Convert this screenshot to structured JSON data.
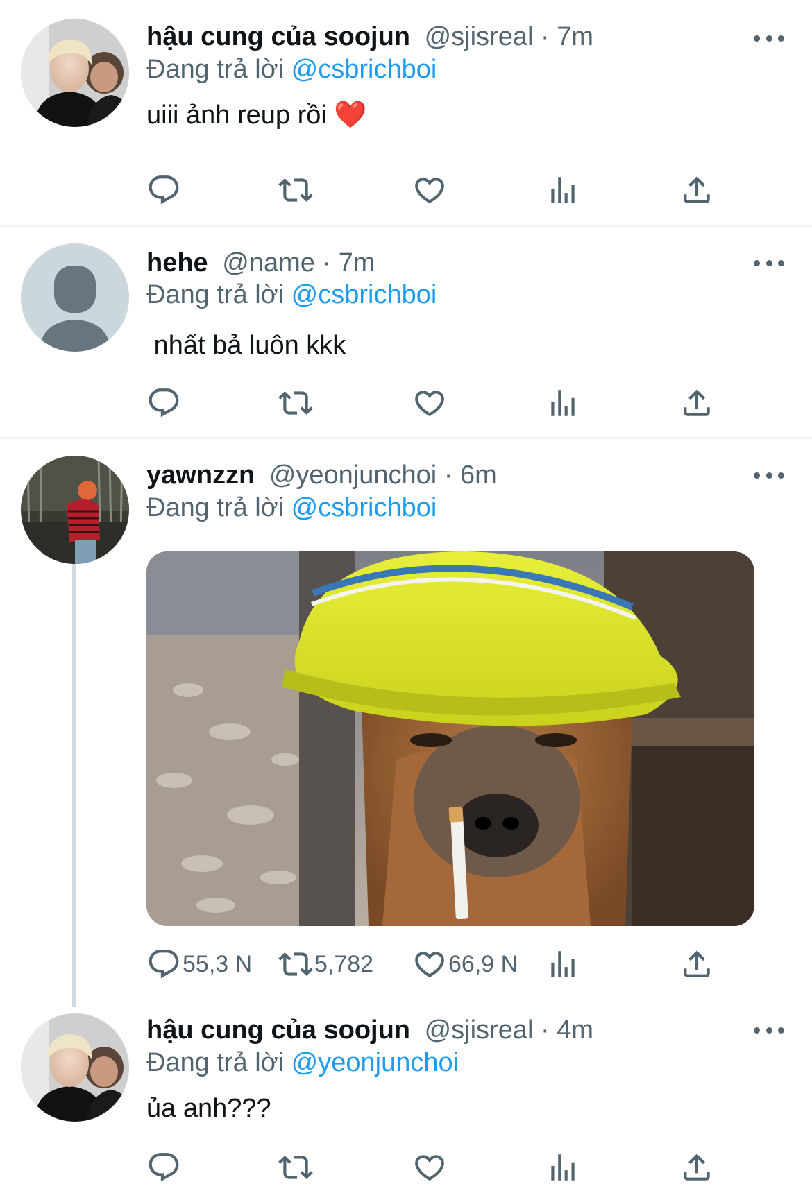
{
  "tweets": [
    {
      "name": "hậu cung của soojun",
      "handle": "@sjisreal",
      "time": "7m",
      "reply_prefix": "Đang trả lời",
      "reply_to": "@csbrichboi",
      "text": "uiii ảnh reup rồi ❤️"
    },
    {
      "name": "hehe",
      "handle": "@name",
      "time": "7m",
      "reply_prefix": "Đang trả lời",
      "reply_to": "@csbrichboi",
      "text": " nhất bả luôn kkk"
    },
    {
      "name": "yawnzzn",
      "handle": "@yeonjunchoi",
      "time": "6m",
      "reply_prefix": "Đang trả lời",
      "reply_to": "@csbrichboi",
      "text": "",
      "counts": {
        "replies": "55,3 N",
        "retweets": "5,782",
        "likes": "66,9 N"
      }
    },
    {
      "name": "hậu cung của soojun",
      "handle": "@sjisreal",
      "time": "4m",
      "reply_prefix": "Đang trả lời",
      "reply_to": "@yeonjunchoi",
      "text": "ủa anh???"
    }
  ],
  "separator": "·",
  "icons": [
    "reply-icon",
    "retweet-icon",
    "like-icon",
    "views-icon",
    "share-icon",
    "more-icon"
  ],
  "colors": {
    "accent": "#1d9bf0",
    "muted": "#536471",
    "text": "#0f1419",
    "divider": "#eff3f4"
  }
}
